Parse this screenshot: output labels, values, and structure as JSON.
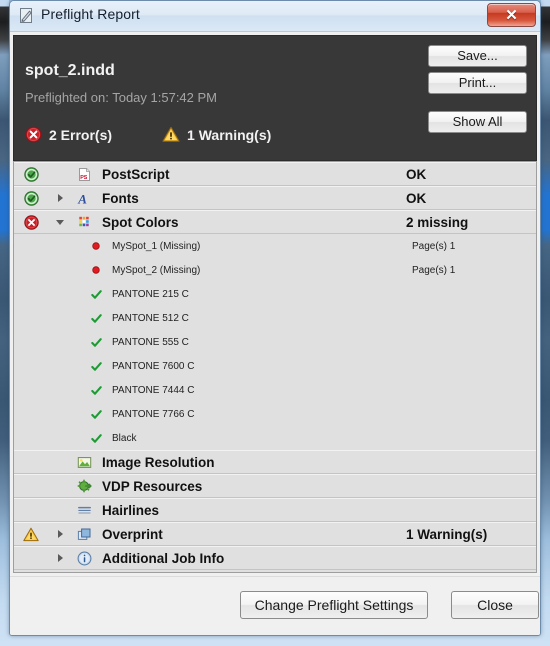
{
  "window": {
    "title": "Preflight Report",
    "title_icon": "document-pencil-icon",
    "close_glyph": "✕"
  },
  "summary": {
    "document_name": "spot_2.indd",
    "preflighted_on": "Preflighted on: Today 1:57:42 PM",
    "error_count_label": "2 Error(s)",
    "warning_count_label": "1 Warning(s)",
    "error_color": "#cc2026",
    "warning_color": "#f0a818",
    "ok_color": "#3f9b3f",
    "background": "#383838",
    "buttons": {
      "save": "Save...",
      "print": "Print...",
      "show_all": "Show All"
    }
  },
  "list": {
    "rows": [
      {
        "level": "top",
        "status": "ok",
        "twisty": "none",
        "icon": "postscript-icon",
        "label": "PostScript",
        "value": "OK"
      },
      {
        "level": "top",
        "status": "ok",
        "twisty": "right",
        "icon": "fonts-icon",
        "label": "Fonts",
        "value": "OK"
      },
      {
        "level": "top",
        "status": "error",
        "twisty": "down",
        "icon": "spot-colors-icon",
        "label": "Spot Colors",
        "value": "2 missing"
      },
      {
        "level": "child",
        "bullet": "dot-red",
        "label": "MySpot_1 (Missing)",
        "value": "Page(s) 1"
      },
      {
        "level": "child",
        "bullet": "dot-red",
        "label": "MySpot_2 (Missing)",
        "value": "Page(s) 1"
      },
      {
        "level": "child",
        "bullet": "check-green",
        "label": "PANTONE 215 C",
        "value": ""
      },
      {
        "level": "child",
        "bullet": "check-green",
        "label": "PANTONE 512 C",
        "value": ""
      },
      {
        "level": "child",
        "bullet": "check-green",
        "label": "PANTONE 555 C",
        "value": ""
      },
      {
        "level": "child",
        "bullet": "check-green",
        "label": "PANTONE 7600 C",
        "value": ""
      },
      {
        "level": "child",
        "bullet": "check-green",
        "label": "PANTONE 7444 C",
        "value": ""
      },
      {
        "level": "child",
        "bullet": "check-green",
        "label": "PANTONE 7766 C",
        "value": ""
      },
      {
        "level": "child",
        "bullet": "check-green",
        "label": "Black",
        "value": ""
      },
      {
        "level": "top",
        "status": "none",
        "twisty": "none",
        "icon": "image-resolution-icon",
        "label": "Image Resolution",
        "value": ""
      },
      {
        "level": "top",
        "status": "none",
        "twisty": "none",
        "icon": "vdp-resources-icon",
        "label": "VDP Resources",
        "value": ""
      },
      {
        "level": "top",
        "status": "none",
        "twisty": "none",
        "icon": "hairlines-icon",
        "label": "Hairlines",
        "value": ""
      },
      {
        "level": "top",
        "status": "warning",
        "twisty": "right",
        "icon": "overprint-icon",
        "label": "Overprint",
        "value": "1 Warning(s)"
      },
      {
        "level": "top",
        "status": "none",
        "twisty": "right",
        "icon": "info-icon",
        "label": "Additional Job Info",
        "value": ""
      }
    ]
  },
  "footer": {
    "change_settings": "Change Preflight Settings",
    "close": "Close"
  }
}
